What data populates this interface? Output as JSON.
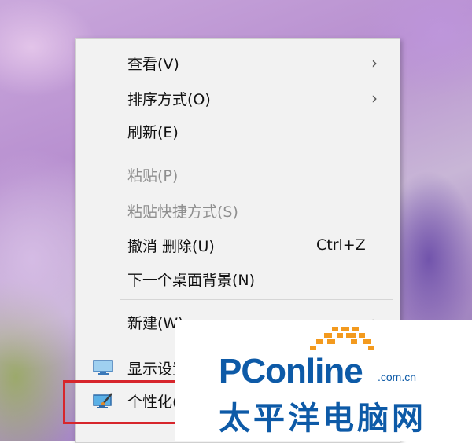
{
  "context_menu": {
    "items": [
      {
        "label": "查看(V)",
        "submenu_arrow": "›",
        "enabled": true
      },
      {
        "label": "排序方式(O)",
        "submenu_arrow": "›",
        "enabled": true
      },
      {
        "label": "刷新(E)",
        "enabled": true
      },
      {
        "label": "粘贴(P)",
        "enabled": false
      },
      {
        "label": "粘贴快捷方式(S)",
        "enabled": false
      },
      {
        "label": "撤消 删除(U)",
        "shortcut": "Ctrl+Z",
        "enabled": true
      },
      {
        "label": "下一个桌面背景(N)",
        "enabled": true
      },
      {
        "label": "新建(W)",
        "submenu_arrow": "›",
        "enabled": true
      },
      {
        "label": "显示设置(D)",
        "icon": "display-settings-icon",
        "enabled": true
      },
      {
        "label": "个性化(R)",
        "icon": "personalize-icon",
        "enabled": true
      }
    ]
  },
  "highlight": {
    "target": "个性化(R)",
    "color": "#d7262c"
  },
  "watermark": {
    "brand": "PConline",
    "domain": ".com.cn",
    "chinese_name": "太平洋电脑网"
  },
  "colors": {
    "menu_background": "#f2f2f2",
    "disabled_text": "#8f8f8f",
    "brand_blue": "#0d5aa7",
    "brand_orange": "#f39a1e"
  }
}
